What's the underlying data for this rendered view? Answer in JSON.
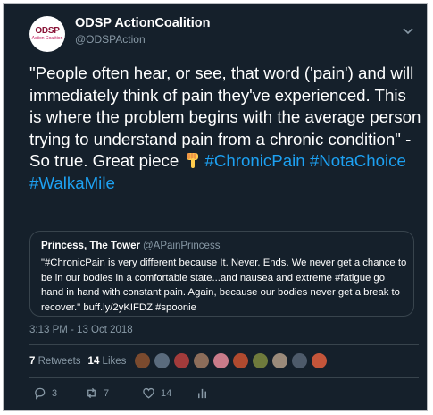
{
  "author": {
    "name": "ODSP ActionCoalition",
    "handle": "@ODSPAction",
    "avatar_text_line1": "ODSP",
    "avatar_text_line2": "Action Coalition"
  },
  "tweet": {
    "text_main": "\"People often hear, or see, that word ('pain') and will immediately think of pain they've experienced. This is where the problem begins with the average person trying to understand pain from a chronic condition\" - So true. Great piece ",
    "emoji_icon": "backhand-index-pointing-down-icon",
    "hashtags": [
      "#ChronicPain",
      "#NotaChoice",
      "#WalkaMile"
    ]
  },
  "quoted_tweet": {
    "name": "Princess, The Tower",
    "handle": "@APainPrincess",
    "text": "\"#ChronicPain is very different because It. Never. Ends. We never get a chance to be in our bodies in a comfortable state...and nausea and extreme #fatigue go hand in hand with constant pain. Again, because our bodies never get a break to recover.\" buff.ly/2yKIFDZ #spoonie"
  },
  "timestamp": "3:13 PM - 13 Oct 2018",
  "stats": {
    "retweets_count": "7",
    "retweets_label": "Retweets",
    "likes_count": "14",
    "likes_label": "Likes"
  },
  "likers_colors": [
    "#7a4a2e",
    "#5a6b7d",
    "#a23b3b",
    "#8c6d5a",
    "#c97b8a",
    "#b04a2f",
    "#6e7a3c",
    "#9a8a7a",
    "#4d5a6a",
    "#c4553a"
  ],
  "actions": {
    "reply_count": "3",
    "retweet_count": "7",
    "like_count": "14"
  },
  "colors": {
    "background": "#15202b",
    "accent": "#1da1f2",
    "secondary_text": "#8899a6",
    "border": "#38444d"
  }
}
